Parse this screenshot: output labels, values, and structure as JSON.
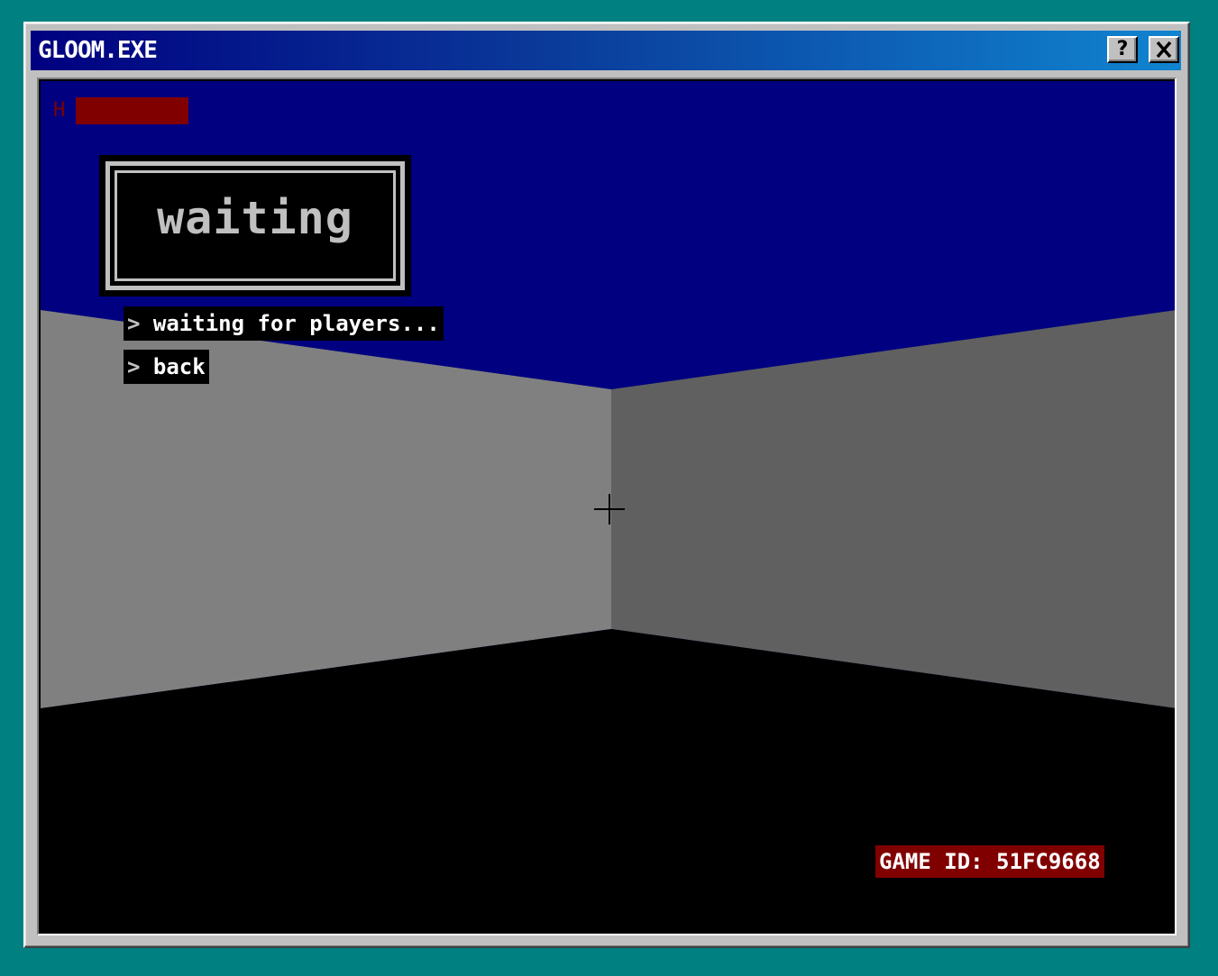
{
  "window": {
    "title": "GLOOM.EXE",
    "help_label": "?",
    "close_label": "✕"
  },
  "hud": {
    "health_label": "H",
    "health_level": 1.0,
    "crosshair_symbol": "+"
  },
  "menu": {
    "heading": "waiting",
    "items": [
      {
        "chevron": ">",
        "label": "waiting for players..."
      },
      {
        "chevron": ">",
        "label": "back"
      }
    ]
  },
  "game_id": "GAME ID: 51FC9668",
  "colors": {
    "desktop": "#008080",
    "ceiling": "#000080",
    "wall_left": "#808080",
    "wall_right": "#606060",
    "floor": "#000000",
    "health": "#800000",
    "game_id_bg": "#800000"
  }
}
